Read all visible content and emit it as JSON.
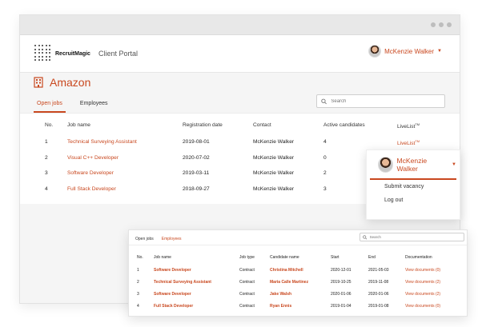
{
  "brand": {
    "name": "RecruitMagic",
    "portal": "Client Portal"
  },
  "user": {
    "name": "McKenzie Walker"
  },
  "company": {
    "name": "Amazon"
  },
  "tabs": [
    "Open jobs",
    "Employees"
  ],
  "search": {
    "placeholder": "Search"
  },
  "jobs_table": {
    "headers": {
      "no": "No.",
      "job": "Job name",
      "registration": "Registration date",
      "contact": "Contact",
      "active": "Active candidates",
      "livelist": "LiveList",
      "livelist_tm": "TM"
    },
    "rows": [
      {
        "no": "1",
        "job": "Technical Surveying Assistant",
        "date": "2019-08-01",
        "contact": "McKenzie Walker",
        "active": "4",
        "livelist": "LiveList",
        "livelist_tm": "TM"
      },
      {
        "no": "2",
        "job": "Visual C++ Developer",
        "date": "2020-07-02",
        "contact": "McKenzie Walker",
        "active": "0"
      },
      {
        "no": "3",
        "job": "Software Developer",
        "date": "2019-03-11",
        "contact": "McKenzie Walker",
        "active": "2"
      },
      {
        "no": "4",
        "job": "Full Stack Developer",
        "date": "2018-09-27",
        "contact": "McKenzie Walker",
        "active": "3"
      }
    ]
  },
  "user_menu": {
    "items": [
      "Submit vacancy",
      "Log out"
    ]
  },
  "employees_card": {
    "tabs": [
      "Open jobs",
      "Employees"
    ],
    "search_placeholder": "Search",
    "headers": {
      "no": "No.",
      "job": "Job name",
      "type": "Job type",
      "candidate": "Candidate name",
      "start": "Start",
      "end": "End",
      "docs": "Documentation"
    },
    "rows": [
      {
        "no": "1",
        "job": "Software Developer",
        "type": "Contract",
        "candidate": "Christina Mitchell",
        "start": "2020-12-01",
        "end": "2021-05-03",
        "docs": "View documents (0)"
      },
      {
        "no": "2",
        "job": "Technical Surveying Assistant",
        "type": "Contract",
        "candidate": "Maria Calle Martinez",
        "start": "2019-10-25",
        "end": "2019-11-08",
        "docs": "View documents (2)"
      },
      {
        "no": "3",
        "job": "Software Developer",
        "type": "Contract",
        "candidate": "Jake Walsh",
        "start": "2020-01-06",
        "end": "2020-01-06",
        "docs": "View documents (2)"
      },
      {
        "no": "4",
        "job": "Full Stack Developer",
        "type": "Contract",
        "candidate": "Ryan Ennis",
        "start": "2019-01-04",
        "end": "2019-01-08",
        "docs": "View documents (0)"
      }
    ]
  },
  "colors": {
    "accent": "#c9481f"
  },
  "icons": [
    "building-icon",
    "search-icon",
    "chevron-down-icon",
    "window-dots-icon"
  ]
}
